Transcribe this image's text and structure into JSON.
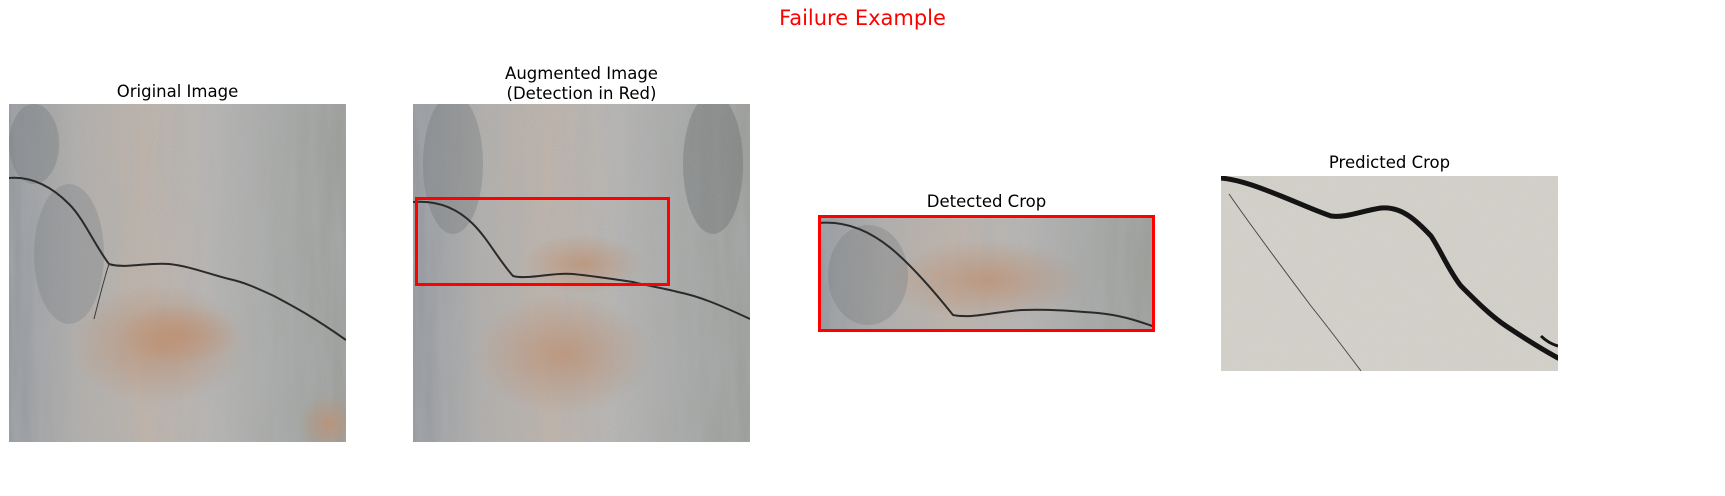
{
  "figure": {
    "title": "Failure Example",
    "title_color": "#ff0000",
    "detection_color": "#ff0000"
  },
  "panels": [
    {
      "title": "Original Image"
    },
    {
      "title": "Augmented Image\n(Detection in Red)"
    },
    {
      "title": "Detected Crop"
    },
    {
      "title": "Predicted Crop"
    }
  ]
}
